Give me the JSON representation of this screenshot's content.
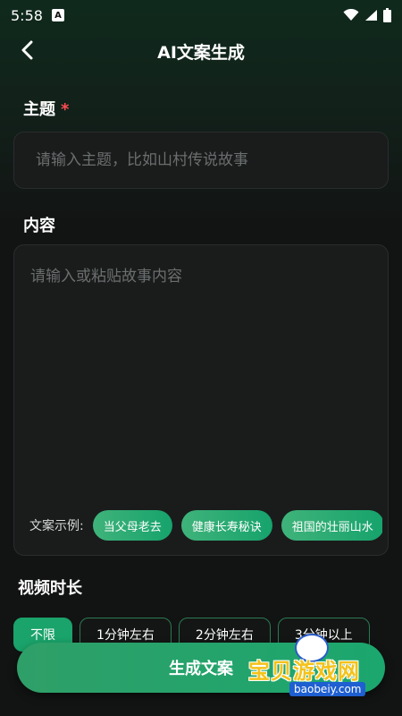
{
  "status_bar": {
    "time": "5:58",
    "notification_icon": "A",
    "icons": [
      "wifi-icon",
      "signal-icon",
      "battery-icon"
    ]
  },
  "header": {
    "title": "AI文案生成",
    "back_icon": "chevron-left-icon"
  },
  "topic": {
    "label": "主题",
    "required_mark": "*",
    "placeholder": "请输入主题，比如山村传说故事",
    "value": ""
  },
  "content": {
    "label": "内容",
    "placeholder": "请输入或粘贴故事内容",
    "value": ""
  },
  "examples": {
    "label": "文案示例:",
    "items": [
      "当父母老去",
      "健康长寿秘诀",
      "祖国的壮丽山水"
    ]
  },
  "duration": {
    "label": "视频时长",
    "options": [
      "不限",
      "1分钟左右",
      "2分钟左右",
      "3分钟以上"
    ],
    "selected": "不限"
  },
  "generate_button": {
    "label": "生成文案"
  },
  "watermark": {
    "text": "宝贝游戏网",
    "url": "baobeiy.com"
  },
  "colors": {
    "accent": "#1aa36a",
    "required": "#ff4d4f",
    "background": "#121313"
  }
}
